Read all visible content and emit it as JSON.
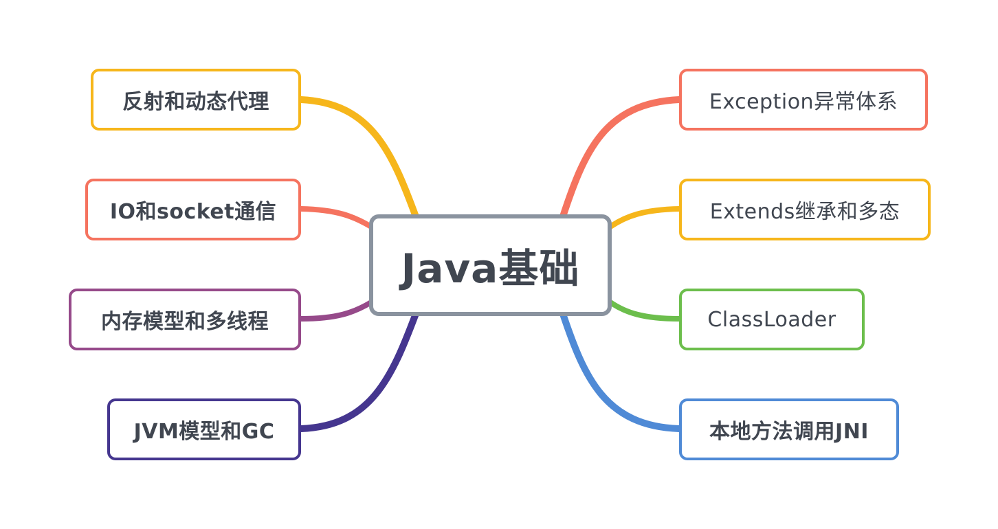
{
  "root": {
    "label": "Java基础"
  },
  "branches_left": [
    {
      "label": "反射和动态代理",
      "color": "#f6b61b"
    },
    {
      "label": "IO和socket通信",
      "color": "#f5735f"
    },
    {
      "label": "内存模型和多线程",
      "color": "#964a8a"
    },
    {
      "label": "JVM模型和GC",
      "color": "#45368f"
    }
  ],
  "branches_right": [
    {
      "label": "Exception异常体系",
      "color": "#f5735f"
    },
    {
      "label": "Extends继承和多态",
      "color": "#f6b61b"
    },
    {
      "label": "ClassLoader",
      "color": "#6cbe4c"
    },
    {
      "label": "本地方法调用JNI",
      "color": "#4f8ad6"
    }
  ],
  "colors": {
    "root_border": "#8a939f",
    "text": "#404650",
    "background": "#ffffff"
  }
}
